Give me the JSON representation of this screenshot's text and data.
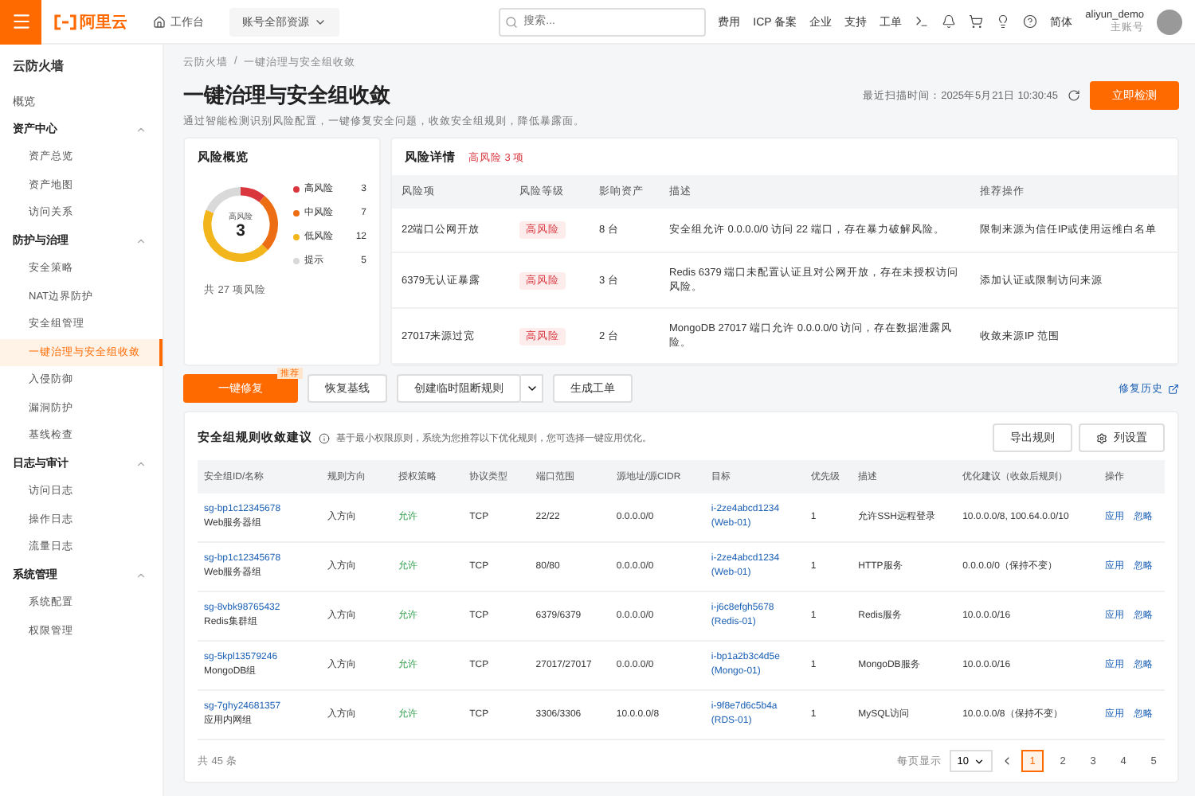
{
  "topbar": {
    "logo": "阿里云",
    "workbench": "工作台",
    "resource_scope": "账号全部资源",
    "search": {
      "placeholder": "搜索..."
    },
    "nav": [
      "费用",
      "ICP 备案",
      "企业",
      "支持",
      "工单"
    ],
    "language": "简体",
    "user": {
      "name": "aliyun_demo",
      "role": "主账号"
    }
  },
  "sidebar": {
    "title": "云防火墙",
    "items": [
      {
        "label": "概览",
        "selected": false
      },
      {
        "label": "资产中心",
        "selected": false,
        "expanded": true,
        "children": [
          {
            "label": "资产总览",
            "selected": false
          },
          {
            "label": "资产地图",
            "selected": false
          },
          {
            "label": "访问关系",
            "selected": false
          }
        ]
      },
      {
        "label": "防护与治理",
        "selected": false,
        "expanded": true,
        "children": [
          {
            "label": "安全策略",
            "selected": false
          },
          {
            "label": "NAT边界防护",
            "selected": false
          },
          {
            "label": "安全组管理",
            "selected": false
          },
          {
            "label": "一键治理与安全组收敛",
            "selected": true
          },
          {
            "label": "入侵防御",
            "selected": false
          },
          {
            "label": "漏洞防护",
            "selected": false
          },
          {
            "label": "基线检查",
            "selected": false
          }
        ]
      },
      {
        "label": "日志与审计",
        "selected": false,
        "expanded": true,
        "children": [
          {
            "label": "访问日志",
            "selected": false
          },
          {
            "label": "操作日志",
            "selected": false
          },
          {
            "label": "流量日志",
            "selected": false
          }
        ]
      },
      {
        "label": "系统管理",
        "selected": false,
        "expanded": true,
        "children": [
          {
            "label": "系统配置",
            "selected": false
          },
          {
            "label": "权限管理",
            "selected": false
          }
        ]
      }
    ]
  },
  "breadcrumb": [
    "云防火墙",
    "一键治理与安全组收敛"
  ],
  "breadcrumb_separator": "/",
  "title": "一键治理与安全组收敛",
  "subtitle": "通过智能检测识别风险配置，一键修复安全问题，收敛安全组规则，降低暴露面。",
  "scan_time": "最近扫描时间：2025年5月21日 10:30:45",
  "scan_button": "立即检测",
  "risk_overview": {
    "title": "风险概览",
    "center_label": "高风险",
    "center_value": "3",
    "total": "共 27 项风险",
    "legend": [
      {
        "count": "3",
        "color": "#d9363e"
      },
      {
        "count": "7",
        "color": "#ec6d12"
      },
      {
        "count": "12",
        "color": "#f2b61c"
      },
      {
        "count": "5",
        "color": "#d9d9d9"
      }
    ],
    "chart_data": {
      "type": "donut",
      "categories": [
        "高风险",
        "中风险",
        "低风险",
        "提示"
      ],
      "values": [
        11.1,
        25.9,
        44.4,
        18.6
      ]
    }
  },
  "risk_details": {
    "title": "风险详情",
    "badge": "高风险 3 项",
    "columns": [
      "风险项",
      "风险等级",
      "影响资产",
      "描述",
      "推荐操作"
    ],
    "rows": [
      {
        "item": "22端口公网开放",
        "level": "高风险",
        "assets": "8 台",
        "description": "安全组允许 0.0.0.0/0 访问 22 端口，存在暴力破解风险。",
        "action": "限制来源为信任IP或使用运维白名单"
      },
      {
        "item": "6379无认证暴露",
        "level": "高风险",
        "assets": "3 台",
        "description": "Redis 6379 端口未配置认证且对公网开放，存在未授权访问风险。",
        "action": "添加认证或限制访问来源"
      },
      {
        "item": "27017来源过宽",
        "level": "高风险",
        "assets": "2 台",
        "description": "MongoDB 27017 端口允许 0.0.0.0/0 访问，存在数据泄露风险。",
        "action": "收敛来源IP 范围"
      }
    ]
  },
  "actions": [
    {
      "label": "一键修复",
      "kind": "primary",
      "badge": "推荐"
    },
    {
      "label": "恢复基线",
      "kind": "default"
    },
    {
      "label": "创建临时阻断规则",
      "kind": "split"
    },
    {
      "label": "生成工单",
      "kind": "default"
    }
  ],
  "history_link": "修复历史",
  "rules": {
    "title": "安全组规则收敛建议",
    "hint": "基于最小权限原则，系统为您推荐以下优化规则，您可选择一键应用优化。",
    "buttons": [
      {
        "label": "导出规则",
        "kind": "plain"
      },
      {
        "label": "列设置",
        "kind": "settings"
      }
    ],
    "columns": [
      "安全组ID/名称",
      "规则方向",
      "授权策略",
      "协议类型",
      "端口范围",
      "源地址/源CIDR",
      "目标",
      "优先级",
      "描述",
      "优化建议（收敛后规则）",
      "操作"
    ],
    "rows": [
      {
        "group_id": "sg-bp1c12345678",
        "group_name": "Web服务器组",
        "direction": "入方向",
        "policy": "允许",
        "protocol": "TCP",
        "port": "22/22",
        "source": "0.0.0.0/0",
        "target_id": "i-2ze4abcd1234",
        "target_name": "(Web-01)",
        "priority": "1",
        "description": "允许SSH远程登录",
        "suggestion": "10.0.0.0/8, 100.64.0.0/10",
        "actions": [
          "应用",
          "忽略"
        ]
      },
      {
        "group_id": "sg-bp1c12345678",
        "group_name": "Web服务器组",
        "direction": "入方向",
        "policy": "允许",
        "protocol": "TCP",
        "port": "80/80",
        "source": "0.0.0.0/0",
        "target_id": "i-2ze4abcd1234",
        "target_name": "(Web-01)",
        "priority": "1",
        "description": "HTTP服务",
        "suggestion": "0.0.0.0/0（保持不变）",
        "actions": [
          "应用",
          "忽略"
        ]
      },
      {
        "group_id": "sg-8vbk98765432",
        "group_name": "Redis集群组",
        "direction": "入方向",
        "policy": "允许",
        "protocol": "TCP",
        "port": "6379/6379",
        "source": "0.0.0.0/0",
        "target_id": "i-j6c8efgh5678",
        "target_name": "(Redis-01)",
        "priority": "1",
        "description": "Redis服务",
        "suggestion": "10.0.0.0/16",
        "actions": [
          "应用",
          "忽略"
        ]
      },
      {
        "group_id": "sg-5kpl13579246",
        "group_name": "MongoDB组",
        "direction": "入方向",
        "policy": "允许",
        "protocol": "TCP",
        "port": "27017/27017",
        "source": "0.0.0.0/0",
        "target_id": "i-bp1a2b3c4d5e",
        "target_name": "(Mongo-01)",
        "priority": "1",
        "description": "MongoDB服务",
        "suggestion": "10.0.0.0/16",
        "actions": [
          "应用",
          "忽略"
        ]
      },
      {
        "group_id": "sg-7ghy24681357",
        "group_name": "应用内网组",
        "direction": "入方向",
        "policy": "允许",
        "protocol": "TCP",
        "port": "3306/3306",
        "source": "10.0.0.0/8",
        "target_id": "i-9f8e7d6c5b4a",
        "target_name": "(RDS-01)",
        "priority": "1",
        "description": "MySQL访问",
        "suggestion": "10.0.0.0/8（保持不变）",
        "actions": [
          "应用",
          "忽略"
        ]
      }
    ],
    "total": "共 45 条",
    "pagination": {
      "per_page_label": "每页显示",
      "per_page": "10",
      "pages": [
        {
          "label": "1",
          "selected": true
        },
        {
          "label": "2",
          "selected": false
        },
        {
          "label": "3",
          "selected": false
        },
        {
          "label": "4",
          "selected": false
        },
        {
          "label": "5",
          "selected": false
        }
      ]
    }
  }
}
